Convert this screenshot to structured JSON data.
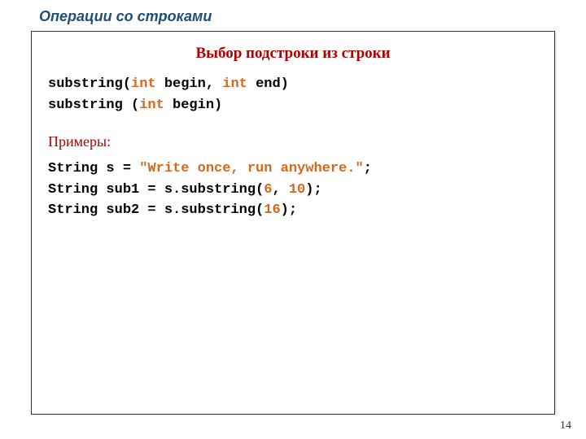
{
  "header": "Операции со строками",
  "subtitle": "Выбор подстроки из строки",
  "sig1": {
    "p1": "substring(",
    "kw1": "int",
    "p2": " begin, ",
    "kw2": "int",
    "p3": " end)"
  },
  "sig2": {
    "p1": "substring (",
    "kw1": "int",
    "p2": " begin)"
  },
  "examples_label": "Примеры:",
  "ex1": {
    "p1": "String s = ",
    "str": "\"Write once, run anywhere.\"",
    "p2": ";"
  },
  "ex2": {
    "p1": "String sub1 = s.substring(",
    "n1": "6",
    "p2": ", ",
    "n2": "10",
    "p3": ");"
  },
  "ex3": {
    "p1": "String sub2 = s.substring(",
    "n1": "16",
    "p2": ");"
  },
  "page_number": "14"
}
